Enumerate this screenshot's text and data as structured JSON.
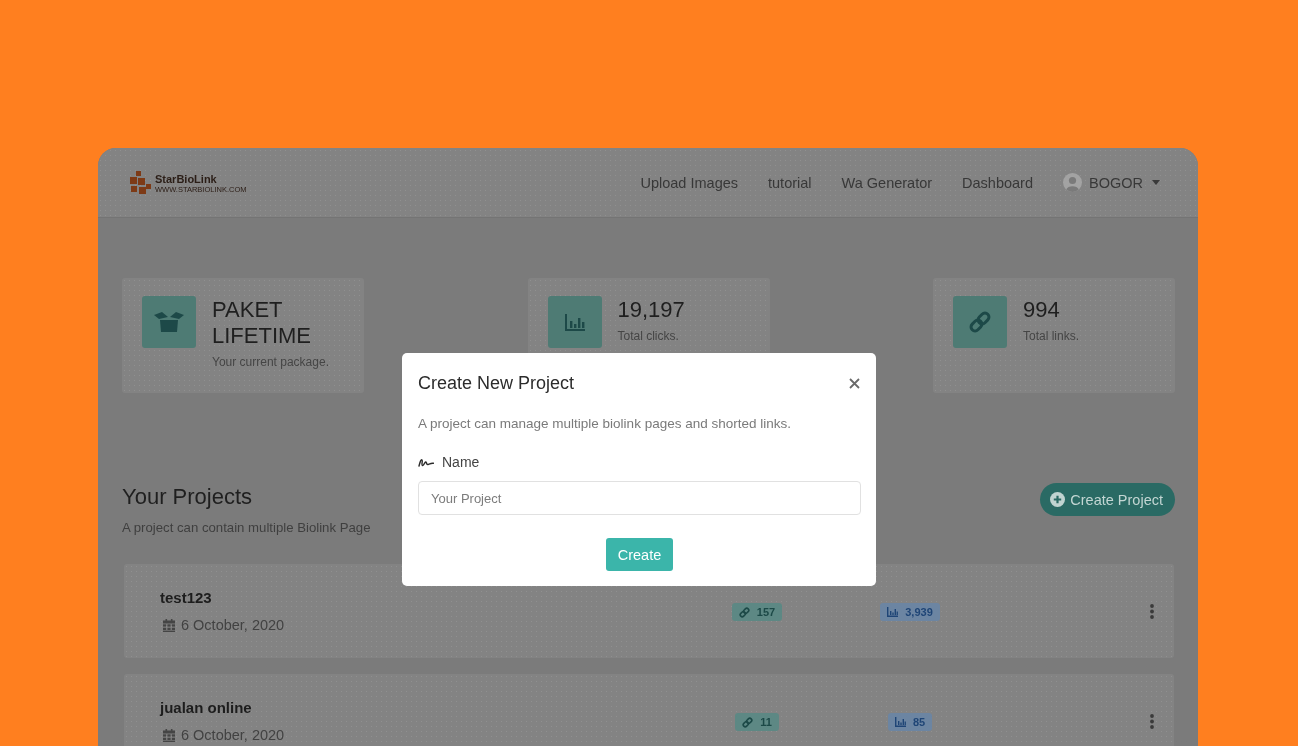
{
  "navbar": {
    "logo": {
      "name": "StarBioLink",
      "tagline": "WWW.STARBIOLINK.COM"
    },
    "links": [
      "Upload Images",
      "tutorial",
      "Wa Generator",
      "Dashboard"
    ],
    "user": {
      "name": "BOGOR"
    }
  },
  "stats": [
    {
      "kind": "package",
      "title": "PAKET LIFETIME",
      "caption": "Your current package."
    },
    {
      "kind": "clicks",
      "title": "19,197",
      "caption": "Total clicks."
    },
    {
      "kind": "links",
      "title": "994",
      "caption": "Total links."
    }
  ],
  "projects_section": {
    "title": "Your Projects",
    "subtitle": "A project can contain multiple Biolink Page",
    "create_button": "Create Project"
  },
  "projects": [
    {
      "name": "test123",
      "date": "6 October, 2020",
      "links": "157",
      "clicks": "3,939"
    },
    {
      "name": "jualan online",
      "date": "6 October, 2020",
      "links": "11",
      "clicks": "85"
    }
  ],
  "modal": {
    "title": "Create New Project",
    "description": "A project can manage multiple biolink pages and shorted links.",
    "field_label": "Name",
    "placeholder": "Your Project",
    "submit": "Create"
  }
}
